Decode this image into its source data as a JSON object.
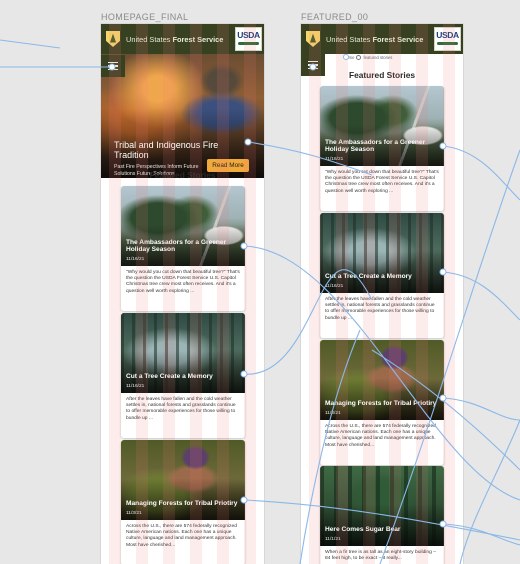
{
  "frames": [
    {
      "label": "HOMEPAGE_FINAL"
    },
    {
      "label": "FEATURED_00"
    }
  ],
  "header": {
    "agency_prefix": "United States ",
    "agency_bold": "Forest Service",
    "usda_logo": "USDA"
  },
  "hero": {
    "title": "Tribal and Indigenous Fire Tradition",
    "subtitle": "Past Fire Perspectives Inform Future Solutions Future Solutions",
    "button": "Read More"
  },
  "featured_title": "Featured Stories",
  "breadcrumb": {
    "home": "home",
    "current": "featured stories"
  },
  "stories": [
    {
      "title": "The Ambassadors for a Greener Holiday Season",
      "date": "11/16/21",
      "excerpt": "\"Why would you cut down that beautiful tree?\" That's the question the USDA Forest Service U.S. Capitol Christmas tree crew most often receives. And it's a question well worth exploring ..."
    },
    {
      "title": "Cut a Tree Create a Memory",
      "date": "11/16/21",
      "excerpt": "After the leaves have fallen and the cold weather settles in, national forests and grasslands continue to offer memorable experiences for those willing to bundle up ..."
    },
    {
      "title": "Managing Forests for Tribal Priotiry",
      "date": "11/3/21",
      "excerpt": "Across the U.S., there are 574 federally recognized Native American nations. Each one has a unique culture, language and land management approach. Most have cherished..."
    },
    {
      "title": "Here Comes Sugar Bear",
      "date": "11/1/21",
      "excerpt": "When a fir tree is as tall as an eight-story building – 84 feet high, to be exact – it really..."
    }
  ],
  "colors": {
    "header_bg": "#384022",
    "button_bg": "#f2a93b",
    "prototype_link": "#8ab8e8",
    "grid_overlay": "#f27878"
  }
}
